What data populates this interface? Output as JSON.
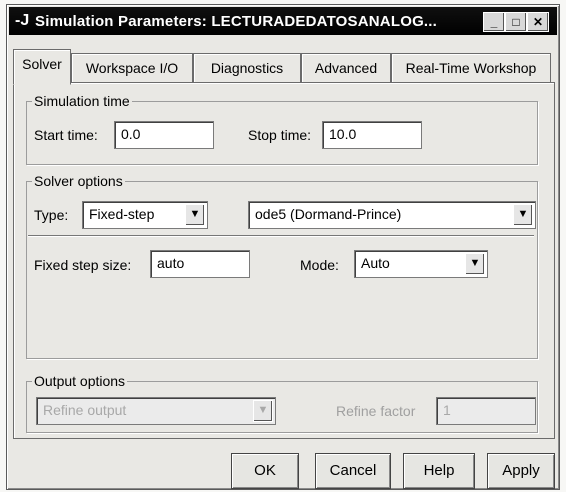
{
  "window": {
    "title": "Simulation Parameters: LECTURADEDATOSANALOG...",
    "app_icon": "simulink-icon",
    "controls": [
      "_",
      "□",
      "✕"
    ]
  },
  "tabs": [
    {
      "label": "Solver",
      "active": true
    },
    {
      "label": "Workspace I/O"
    },
    {
      "label": "Diagnostics"
    },
    {
      "label": "Advanced"
    },
    {
      "label": "Real-Time Workshop"
    }
  ],
  "simulation_time": {
    "group_label": "Simulation time",
    "start_label": "Start time:",
    "start_value": "0.0",
    "stop_label": "Stop time:",
    "stop_value": "10.0"
  },
  "solver_options": {
    "group_label": "Solver options",
    "type_label": "Type:",
    "type_value": "Fixed-step",
    "solver_value": "ode5 (Dormand-Prince)",
    "step_label": "Fixed step size:",
    "step_value": "auto",
    "mode_label": "Mode:",
    "mode_value": "Auto"
  },
  "output_options": {
    "group_label": "Output options",
    "refine_select": "Refine output",
    "refine_label": "Refine factor",
    "refine_value": "1"
  },
  "buttons": {
    "ok": "OK",
    "cancel": "Cancel",
    "help": "Help",
    "apply": "Apply"
  }
}
